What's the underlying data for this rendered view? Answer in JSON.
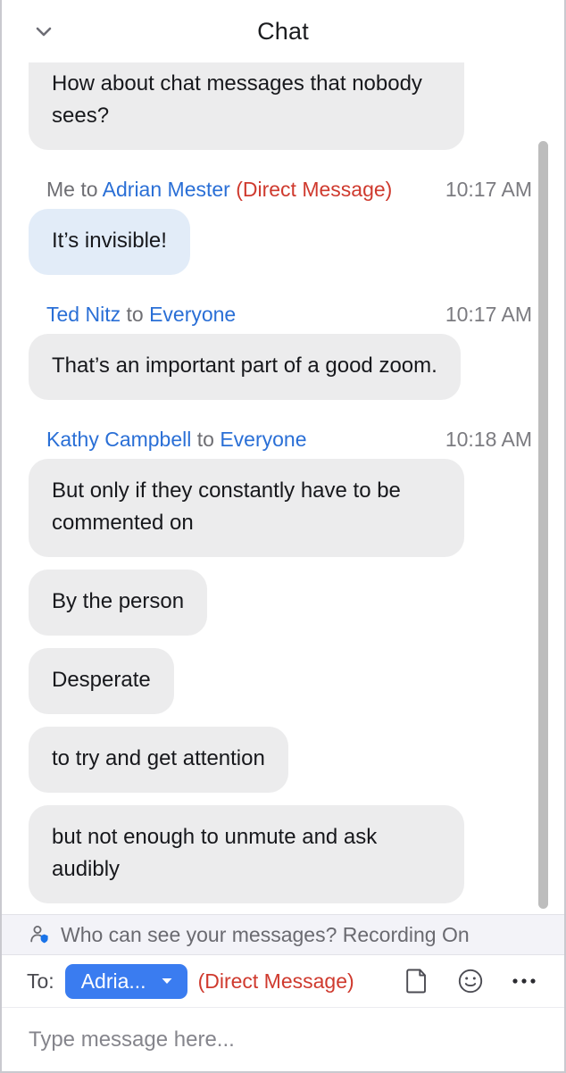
{
  "header": {
    "title": "Chat",
    "collapse_icon": "chevron-down-icon"
  },
  "messages": [
    {
      "id": "m0",
      "clipped": true,
      "has_meta": false,
      "bubble_style": "gray",
      "text": "How about chat messages that nobody sees?"
    },
    {
      "id": "m1",
      "clipped": false,
      "has_meta": true,
      "sender": "Me",
      "sender_color": "gray",
      "to_word": "to",
      "target": "Adrian Mester",
      "target_color": "blue",
      "dm_tag": "(Direct Message)",
      "time": "10:17 AM",
      "bubble_style": "blue",
      "text": "It’s invisible!"
    },
    {
      "id": "m2",
      "clipped": false,
      "has_meta": true,
      "sender": "Ted Nitz",
      "sender_color": "blue",
      "to_word": "to",
      "target": "Everyone",
      "target_color": "blue",
      "dm_tag": "",
      "time": "10:17 AM",
      "bubble_style": "gray",
      "text": "That’s an important part of a good zoom."
    },
    {
      "id": "m3",
      "clipped": false,
      "has_meta": true,
      "sender": "Kathy Campbell",
      "sender_color": "blue",
      "to_word": "to",
      "target": "Everyone",
      "target_color": "blue",
      "dm_tag": "",
      "time": "10:18 AM",
      "bubble_style": "gray",
      "text": "But only if they constantly have to be commented on"
    },
    {
      "id": "m4",
      "clipped": false,
      "has_meta": false,
      "bubble_style": "gray",
      "text": "By the person"
    },
    {
      "id": "m5",
      "clipped": false,
      "has_meta": false,
      "bubble_style": "gray",
      "text": "Desperate"
    },
    {
      "id": "m6",
      "clipped": false,
      "has_meta": false,
      "bubble_style": "gray",
      "text": "to try and get attention"
    },
    {
      "id": "m7",
      "clipped": false,
      "has_meta": false,
      "bubble_style": "gray",
      "text": "but not enough to unmute and ask audibly"
    }
  ],
  "notice": {
    "icon": "person-shield-icon",
    "text": "Who can see your messages? Recording On"
  },
  "composer": {
    "to_label": "To:",
    "recipient": "Adria...",
    "recipient_caret_icon": "caret-down-icon",
    "dm_label": "(Direct Message)",
    "file_icon": "file-icon",
    "emoji_icon": "smiley-icon",
    "more_icon": "ellipsis-icon",
    "input_value": "",
    "input_placeholder": "Type message here..."
  },
  "colors": {
    "accent_blue": "#3a7cf0",
    "name_blue": "#2a6fd6",
    "dm_red": "#cf3a2e",
    "bubble_gray": "#ececed",
    "bubble_blue": "#e2ecf8",
    "notice_bg": "#f3f3f8"
  }
}
